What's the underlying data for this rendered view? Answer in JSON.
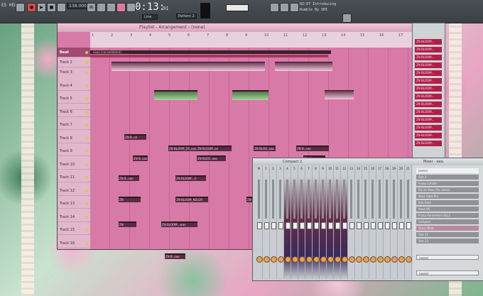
{
  "toolbar": {
    "menu_label": "ES HELP",
    "tempo": "138.000",
    "time": "0:13:",
    "time_small": "91",
    "pattern": "Pattern 2",
    "snap": "Line",
    "hint_line1": "02:07 Introducing",
    "hint_line2": "Rumble By UHI"
  },
  "playlist": {
    "title": "Playlist - Arrangement › (none)",
    "ruler": [
      "1",
      "2",
      "3",
      "4",
      "5",
      "6",
      "7",
      "8",
      "9",
      "10",
      "11",
      "12",
      "13",
      "14",
      "15",
      "16",
      "17"
    ],
    "ribbon_label": "eeaa [consolidated]",
    "tracks": [
      "Beat",
      "Track 2",
      "Track 3",
      "Track 4",
      "Track 5",
      "Track 6",
      "Track 7",
      "Track 8",
      "Track 9",
      "Track 10",
      "Track 11",
      "Track 12",
      "Track 13",
      "Track 14",
      "Track 15",
      "Track 16"
    ],
    "clip_labels": [
      "ZN B..on",
      "ZN BLOOM_ZX_ooo",
      "ZN BLOOM..oo",
      "ZN BLOO..ooo",
      "ZN B..ooo",
      "ZN BLOOM...2-W..ooo",
      "ZN BL..ooo",
      "ZN BLOOM_KOLOR",
      "ZN BLOOM..hm.wav",
      "ZN BLOOM...wav"
    ]
  },
  "rack": {
    "items": [
      "ZN BLOOM...",
      "ZN BLOOM...",
      "ZN BLOOM...",
      "ZN BLOOM...",
      "ZN BLOOM...",
      "ZN BLOOM...",
      "ZN BLOOM...",
      "ZN BLOOM...",
      "ZN BLOOM...",
      "ZN BLOOM...",
      "ZN BLOOM...",
      "ZN BLOOM...",
      "ZN BLOOM...",
      "ZN BLOOM..."
    ]
  },
  "mixer": {
    "title": "Compact 2",
    "side_title": "Mixer - eea",
    "strips": [
      "M",
      "1",
      "2",
      "3",
      "4",
      "5",
      "6",
      "7",
      "8",
      "9",
      "10",
      "11",
      "12",
      "13",
      "14",
      "15",
      "16",
      "17",
      "18",
      "19",
      "20",
      "21"
    ],
    "slots": [
      "(none)",
      "Slot 1",
      "Fruity Limiter",
      "EQ 2x Voxa (for voice)",
      "Voxa Gate Pro",
      "Kilo Gate",
      "Voxa OS",
      "Fruity Parametric EQ 2",
      "compare",
      "Gross Beat",
      "Slot 11",
      "Slot 12"
    ],
    "input_none": "(none)",
    "output_none": "(none)"
  },
  "colors": {
    "accent": "#e07a9a",
    "playlist_bg": "#d77aa8",
    "clip_dark": "#5a2c44",
    "rack_item": "#b11e48"
  }
}
